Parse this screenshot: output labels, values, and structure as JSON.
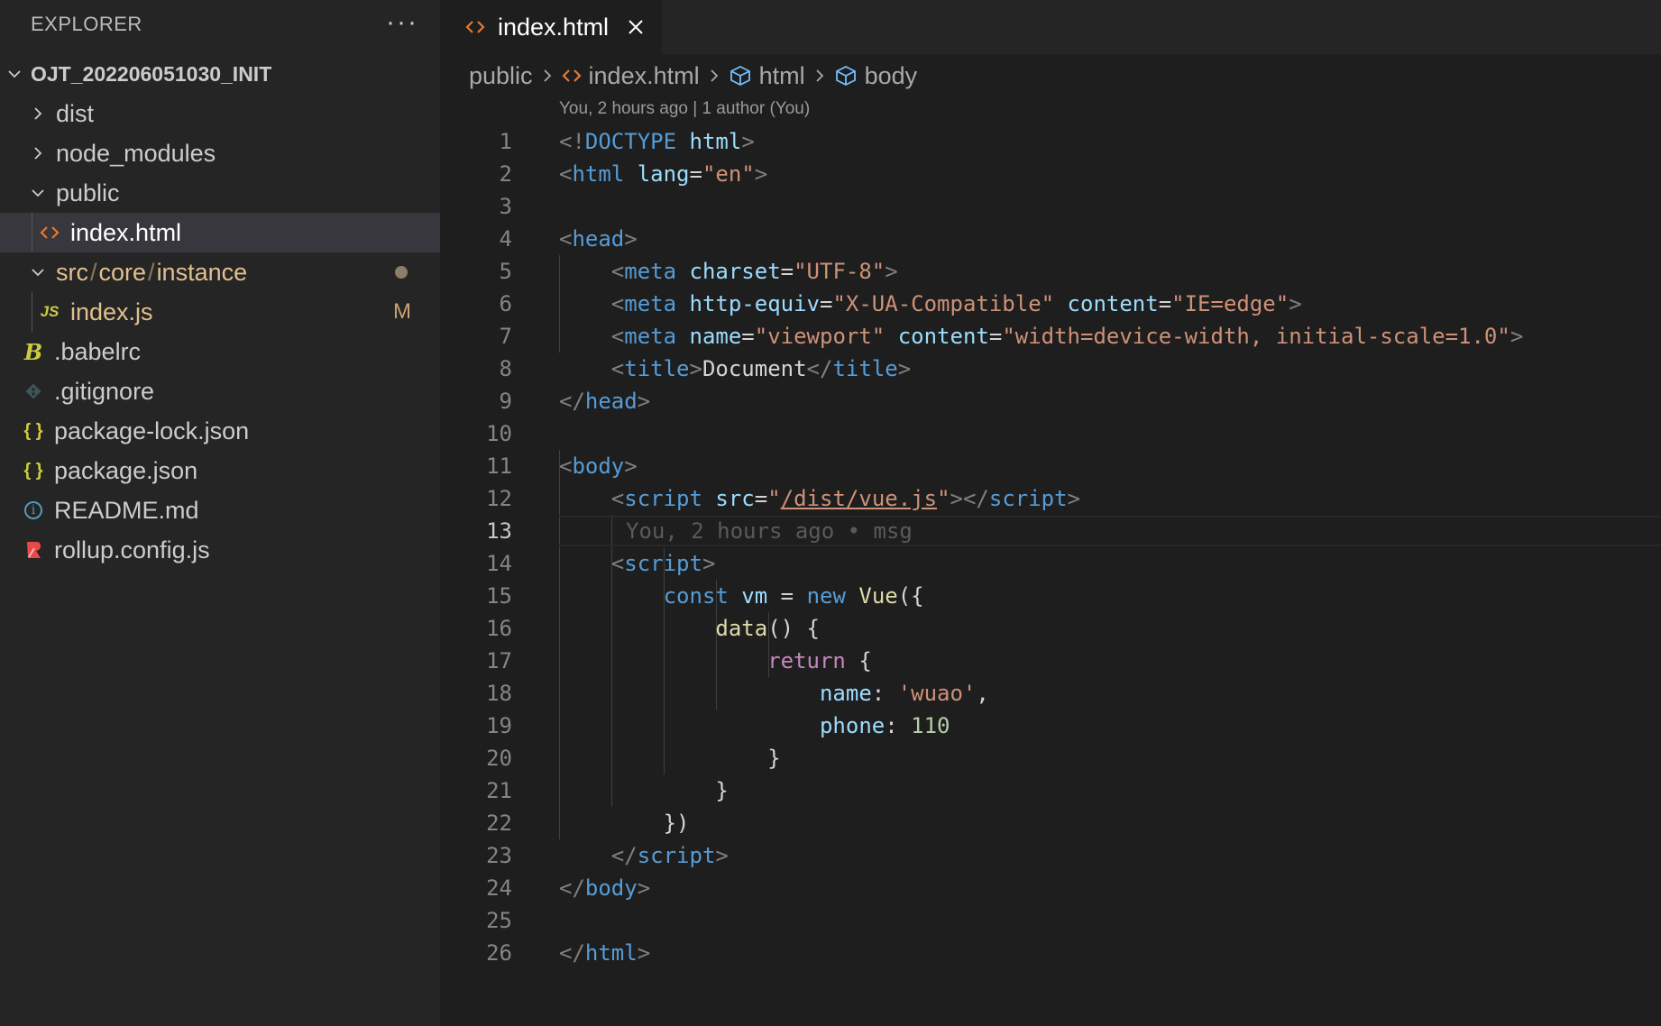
{
  "explorer": {
    "title": "EXPLORER",
    "more": "···",
    "root": "OJT_202206051030_INIT",
    "items": [
      {
        "label": "dist"
      },
      {
        "label": "node_modules"
      },
      {
        "label": "public"
      },
      {
        "label": "index.html"
      },
      {
        "label_parts": [
          "src",
          "/",
          "core",
          "/",
          "instance"
        ]
      },
      {
        "label": "index.js",
        "badge": "M"
      },
      {
        "label": ".babelrc"
      },
      {
        "label": ".gitignore"
      },
      {
        "label": "package-lock.json"
      },
      {
        "label": "package.json"
      },
      {
        "label": "README.md"
      },
      {
        "label": "rollup.config.js"
      }
    ],
    "icons": {
      "js": "JS",
      "json": "{ }",
      "babel": "B",
      "info": "i"
    }
  },
  "tab": {
    "label": "index.html"
  },
  "breadcrumb": [
    "public",
    "index.html",
    "html",
    "body"
  ],
  "codelens": "You, 2 hours ago | 1 author (You)",
  "ghost_blame": "You, 2 hours ago • msg",
  "line_numbers": [
    "1",
    "2",
    "3",
    "4",
    "5",
    "6",
    "7",
    "8",
    "9",
    "10",
    "11",
    "12",
    "13",
    "14",
    "15",
    "16",
    "17",
    "18",
    "19",
    "20",
    "21",
    "22",
    "23",
    "24",
    "25",
    "26"
  ],
  "code": {
    "l1": [
      "<!",
      "DOCTYPE",
      " ",
      "html",
      ">"
    ],
    "l2": [
      "<",
      "html",
      " ",
      "lang",
      "=",
      "\"en\"",
      ">"
    ],
    "l4": [
      "<",
      "head",
      ">"
    ],
    "l5": [
      "    ",
      "<",
      "meta",
      " ",
      "charset",
      "=",
      "\"UTF-8\"",
      ">"
    ],
    "l6": [
      "    ",
      "<",
      "meta",
      " ",
      "http-equiv",
      "=",
      "\"X-UA-Compatible\"",
      " ",
      "content",
      "=",
      "\"IE=edge\"",
      ">"
    ],
    "l7": [
      "    ",
      "<",
      "meta",
      " ",
      "name",
      "=",
      "\"viewport\"",
      " ",
      "content",
      "=",
      "\"width=device-width, initial-scale=1.0\"",
      ">"
    ],
    "l8": [
      "    ",
      "<",
      "title",
      ">",
      "Document",
      "</",
      "title",
      ">"
    ],
    "l9": [
      "</",
      "head",
      ">"
    ],
    "l11": [
      "<",
      "body",
      ">"
    ],
    "l12": [
      "    ",
      "<",
      "script",
      " ",
      "src",
      "=",
      "\"",
      "/dist/vue.js",
      "\"",
      "></",
      "script",
      ">"
    ],
    "l14": [
      "    ",
      "<",
      "script",
      ">"
    ],
    "l15": [
      "        ",
      "const",
      " ",
      "vm",
      " = ",
      "new",
      " ",
      "Vue",
      "({"
    ],
    "l16": [
      "            ",
      "data",
      "() {"
    ],
    "l17": [
      "                ",
      "return",
      " {"
    ],
    "l18": [
      "                    ",
      "name",
      ": ",
      "'wuao'",
      ","
    ],
    "l19": [
      "                    ",
      "phone",
      ": ",
      "110"
    ],
    "l20": [
      "                ",
      "}"
    ],
    "l21": [
      "            ",
      "}"
    ],
    "l22": [
      "        ",
      "})"
    ],
    "l23": [
      "    ",
      "</",
      "script",
      ">"
    ],
    "l24": [
      "</",
      "body",
      ">"
    ],
    "l26": [
      "</",
      "html",
      ">"
    ]
  }
}
